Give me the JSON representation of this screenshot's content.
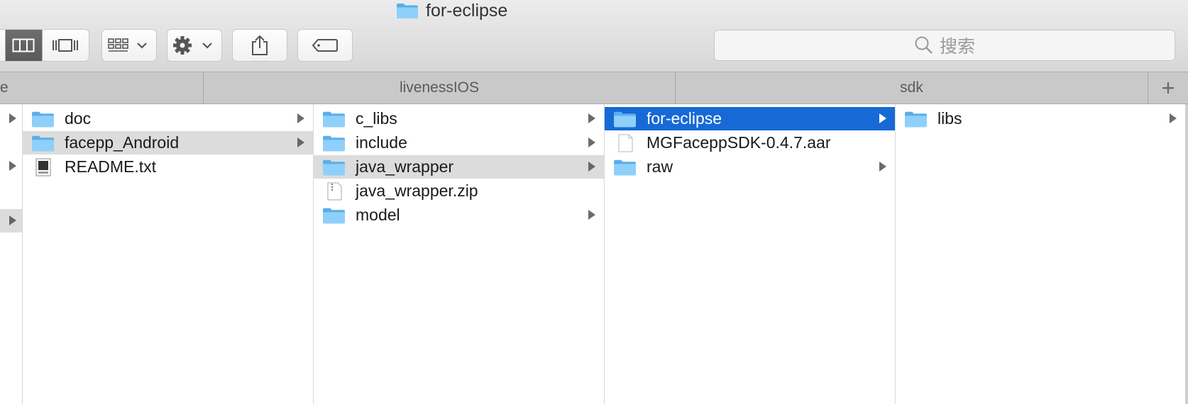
{
  "window": {
    "title": "for-eclipse"
  },
  "search": {
    "placeholder": "搜索"
  },
  "tabs": [
    {
      "label": "e"
    },
    {
      "label": "livenessIOS"
    },
    {
      "label": "sdk"
    }
  ],
  "tab_add": {
    "label": "+"
  },
  "columns": [
    {
      "rows": [
        {
          "label": "doc",
          "type": "folder"
        },
        {
          "label": "facepp_Android",
          "type": "folder"
        },
        {
          "label": "README.txt",
          "type": "text"
        }
      ]
    },
    {
      "rows": [
        {
          "label": "c_libs",
          "type": "folder"
        },
        {
          "label": "include",
          "type": "folder"
        },
        {
          "label": "java_wrapper",
          "type": "folder"
        },
        {
          "label": "java_wrapper.zip",
          "type": "zip"
        },
        {
          "label": "model",
          "type": "folder"
        }
      ]
    },
    {
      "rows": [
        {
          "label": "for-eclipse",
          "type": "folder"
        },
        {
          "label": "MGFaceppSDK-0.4.7.aar",
          "type": "file"
        },
        {
          "label": "raw",
          "type": "folder"
        }
      ]
    },
    {
      "rows": [
        {
          "label": "libs",
          "type": "folder"
        }
      ]
    }
  ],
  "colors": {
    "selection": "#1769d6",
    "highlight": "#dcdcdc",
    "folder": "#5fb6f0"
  },
  "icons": [
    "folder-icon",
    "column-view-icon",
    "cover-flow-icon",
    "grid-icon",
    "gear-icon",
    "share-icon",
    "tag-icon",
    "search-icon",
    "chevron-down-icon",
    "arrow-right-icon",
    "text-file-icon",
    "zip-file-icon",
    "document-icon"
  ]
}
